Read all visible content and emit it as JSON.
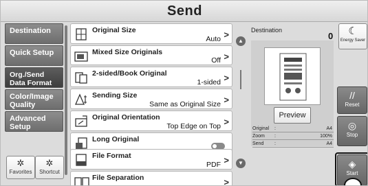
{
  "title": "Send",
  "nav": {
    "items": [
      {
        "label": "Destination",
        "active": false
      },
      {
        "label": "Quick Setup",
        "active": false
      },
      {
        "label": "Org./Send Data Format",
        "active": true
      },
      {
        "label": "Color/Image Quality",
        "active": false
      },
      {
        "label": "Advanced Setup",
        "active": false
      }
    ],
    "favorites_label": "Favorites",
    "shortcut_label": "Shortcut"
  },
  "settings": [
    {
      "title": "Original Size",
      "value": "Auto",
      "icon": "original-size-icon",
      "control": "chevron"
    },
    {
      "title": "Mixed Size Originals",
      "value": "Off",
      "icon": "mixed-size-icon",
      "control": "chevron"
    },
    {
      "title": "2-sided/Book Original",
      "value": "1-sided",
      "icon": "two-sided-icon",
      "control": "chevron"
    },
    {
      "title": "Sending Size",
      "value": "Same as Original Size",
      "icon": "sending-size-icon",
      "control": "chevron"
    },
    {
      "title": "Original Orientation",
      "value": "Top Edge on Top",
      "icon": "orientation-icon",
      "control": "chevron"
    },
    {
      "title": "Long Original",
      "value": "",
      "icon": "long-original-icon",
      "control": "toggle",
      "toggle_on": false
    },
    {
      "title": "File Format",
      "value": "PDF",
      "icon": "file-format-icon",
      "control": "chevron"
    },
    {
      "title": "File Separation",
      "value": "",
      "icon": "file-separation-icon",
      "control": "chevron"
    }
  ],
  "preview": {
    "destination_label": "Destination",
    "destination_count": "0",
    "button_label": "Preview",
    "info": [
      {
        "key": "Original",
        "value": "A4"
      },
      {
        "key": "Zoom",
        "value": "100%"
      },
      {
        "key": "Send",
        "value": "A4"
      }
    ]
  },
  "right": {
    "energy_saver": "Energy Saver",
    "reset": "Reset",
    "stop": "Stop",
    "start": "Start"
  },
  "colors": {
    "nav_bg": "#7a7a7a",
    "nav_active": "#4a4a4a",
    "row_bg": "#ffffff",
    "frame_bg": "#dcdcdc"
  }
}
